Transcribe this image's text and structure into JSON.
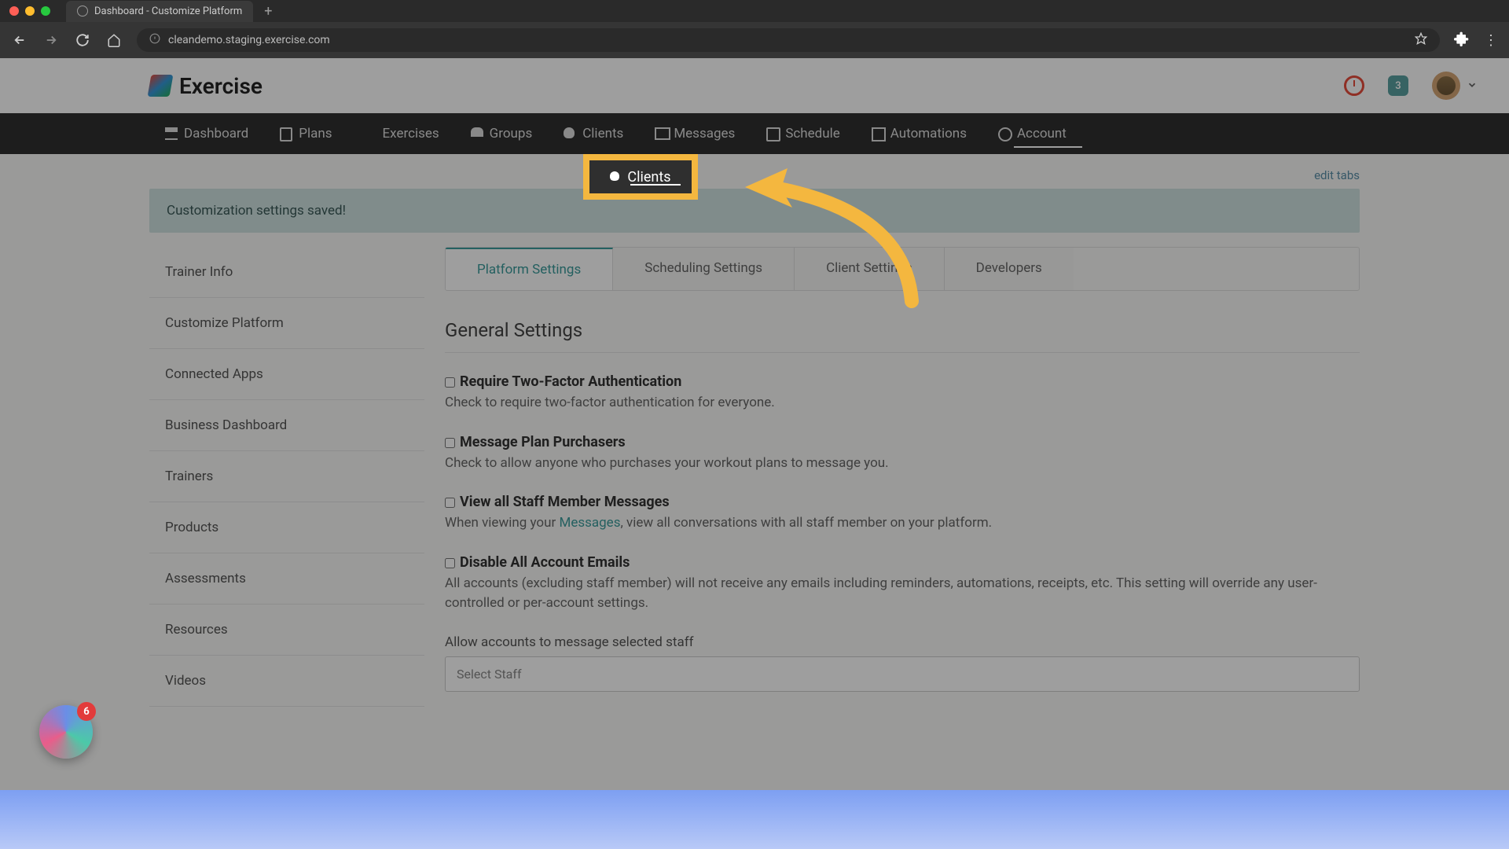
{
  "browser": {
    "tab_title": "Dashboard - Customize Platform",
    "url": "cleandemo.staging.exercise.com"
  },
  "header": {
    "brand": "Exercise",
    "notif_count": "3"
  },
  "nav": {
    "dashboard": "Dashboard",
    "plans": "Plans",
    "exercises": "Exercises",
    "groups": "Groups",
    "clients": "Clients",
    "messages": "Messages",
    "schedule": "Schedule",
    "automations": "Automations",
    "account": "Account"
  },
  "edit_tabs": "edit tabs",
  "alert": "Customization settings saved!",
  "sidebar": {
    "items": [
      "Trainer Info",
      "Customize Platform",
      "Connected Apps",
      "Business Dashboard",
      "Trainers",
      "Products",
      "Assessments",
      "Resources",
      "Videos"
    ]
  },
  "tabs": {
    "platform": "Platform Settings",
    "scheduling": "Scheduling Settings",
    "client": "Client Settings",
    "developers": "Developers"
  },
  "section_title": "General Settings",
  "settings": {
    "two_factor": {
      "label": "Require Two-Factor Authentication",
      "desc": "Check to require two-factor authentication for everyone."
    },
    "msg_plan": {
      "label": "Message Plan Purchasers",
      "desc": "Check to allow anyone who purchases your workout plans to message you."
    },
    "view_staff": {
      "label": "View all Staff Member Messages",
      "desc_pre": "When viewing your ",
      "link": "Messages",
      "desc_post": ", view all conversations with all staff member on your platform."
    },
    "disable_emails": {
      "label": "Disable All Account Emails",
      "desc": "All accounts (excluding staff member) will not receive any emails including reminders, automations, receipts, etc. This setting will override any user-controlled or per-account settings."
    },
    "allow_msg_label": "Allow accounts to message selected staff",
    "select_placeholder": "Select Staff"
  },
  "widget_badge": "6"
}
